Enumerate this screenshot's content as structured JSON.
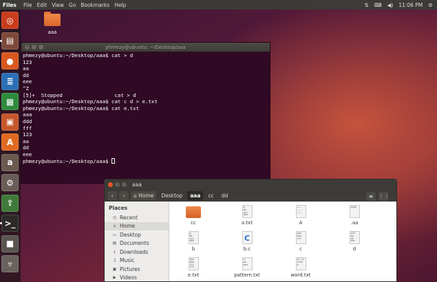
{
  "topbar": {
    "app": "Files",
    "menu": [
      "File",
      "Edit",
      "View",
      "Go",
      "Bookmarks",
      "Help"
    ],
    "time": "11:06 PM"
  },
  "launcher": [
    {
      "name": "ubuntu-dash-icon",
      "color": "#c93c1c",
      "glyph": "◎"
    },
    {
      "name": "files-icon",
      "color": "#7d4a3a",
      "glyph": "▤"
    },
    {
      "name": "firefox-icon",
      "color": "#d9581f",
      "glyph": "●"
    },
    {
      "name": "writer-icon",
      "color": "#2a6fb5",
      "glyph": "≣"
    },
    {
      "name": "calc-icon",
      "color": "#2e8b3d",
      "glyph": "▦"
    },
    {
      "name": "impress-icon",
      "color": "#c6572c",
      "glyph": "▣"
    },
    {
      "name": "software-center-icon",
      "color": "#e06a22",
      "glyph": "A"
    },
    {
      "name": "amazon-icon",
      "color": "#6a5a4f",
      "glyph": "a"
    },
    {
      "name": "settings-icon",
      "color": "#6a5d58",
      "glyph": "⚙"
    },
    {
      "name": "updater-icon",
      "color": "#3f7a3a",
      "glyph": "⇪"
    },
    {
      "name": "terminal-icon",
      "color": "#2c2b29",
      "glyph": ">_"
    },
    {
      "name": "drive-icon",
      "color": "#5b5551",
      "glyph": "■"
    },
    {
      "name": "trash-icon",
      "color": "#6a625e",
      "glyph": "▿"
    }
  ],
  "desktop_icon": {
    "label": "aaa"
  },
  "terminal": {
    "title": "phmezy@ubuntu: ~/Desktop/aaa",
    "lines": [
      "phmezy@ubuntu:~/Desktop/aaa$ cat > d",
      "123",
      "aa",
      "dd",
      "eee",
      "^Z",
      "[5]+  Stopped                 cat > d",
      "phmezy@ubuntu:~/Desktop/aaa$ cat c d > e.txt",
      "phmezy@ubuntu:~/Desktop/aaa$ cat e.txt",
      "aaa",
      "ddd",
      "fff",
      "123",
      "aa",
      "dd",
      "eee"
    ],
    "prompt": "phmezy@ubuntu:~/Desktop/aaa$ "
  },
  "files": {
    "title": "aaa",
    "breadcrumbs": [
      "Home",
      "Desktop",
      "aaa",
      "cc",
      "dd"
    ],
    "places_header": "Places",
    "places": [
      {
        "icon": "recent-icon",
        "glyph": "◷",
        "label": "Recent"
      },
      {
        "icon": "home-icon",
        "glyph": "⌂",
        "label": "Home"
      },
      {
        "icon": "desktop-icon",
        "glyph": "▭",
        "label": "Desktop"
      },
      {
        "icon": "documents-icon",
        "glyph": "▤",
        "label": "Documents"
      },
      {
        "icon": "downloads-icon",
        "glyph": "↓",
        "label": "Downloads"
      },
      {
        "icon": "music-icon",
        "glyph": "♫",
        "label": "Music"
      },
      {
        "icon": "pictures-icon",
        "glyph": "▣",
        "label": "Pictures"
      },
      {
        "icon": "videos-icon",
        "glyph": "▶",
        "label": "Videos"
      }
    ],
    "items": [
      {
        "label": "cc",
        "kind": "folder",
        "preview": ""
      },
      {
        "label": "a.txt",
        "kind": "text",
        "preview": "a\nbb\nccc\nddd"
      },
      {
        "label": "A",
        "kind": "text",
        "preview": "———\n———\n———"
      },
      {
        "label": ".aa",
        "kind": "text",
        "preview": "aaaa"
      },
      {
        "label": "b",
        "kind": "text",
        "preview": "a\nbb\nccc\nddd"
      },
      {
        "label": "b.c",
        "kind": "csource",
        "preview": "C"
      },
      {
        "label": "c",
        "kind": "text",
        "preview": "aaa\nddd\nfff"
      },
      {
        "label": "d",
        "kind": "text",
        "preview": "123\naa\ndd\neee"
      },
      {
        "label": "e.txt",
        "kind": "text",
        "preview": "aaa\nddd\nfff\n123"
      },
      {
        "label": "pattern.txt",
        "kind": "text",
        "preview": "a\naa\naaa"
      },
      {
        "label": "word.txt",
        "kind": "text",
        "preview": "it is\n1234\na"
      }
    ]
  }
}
